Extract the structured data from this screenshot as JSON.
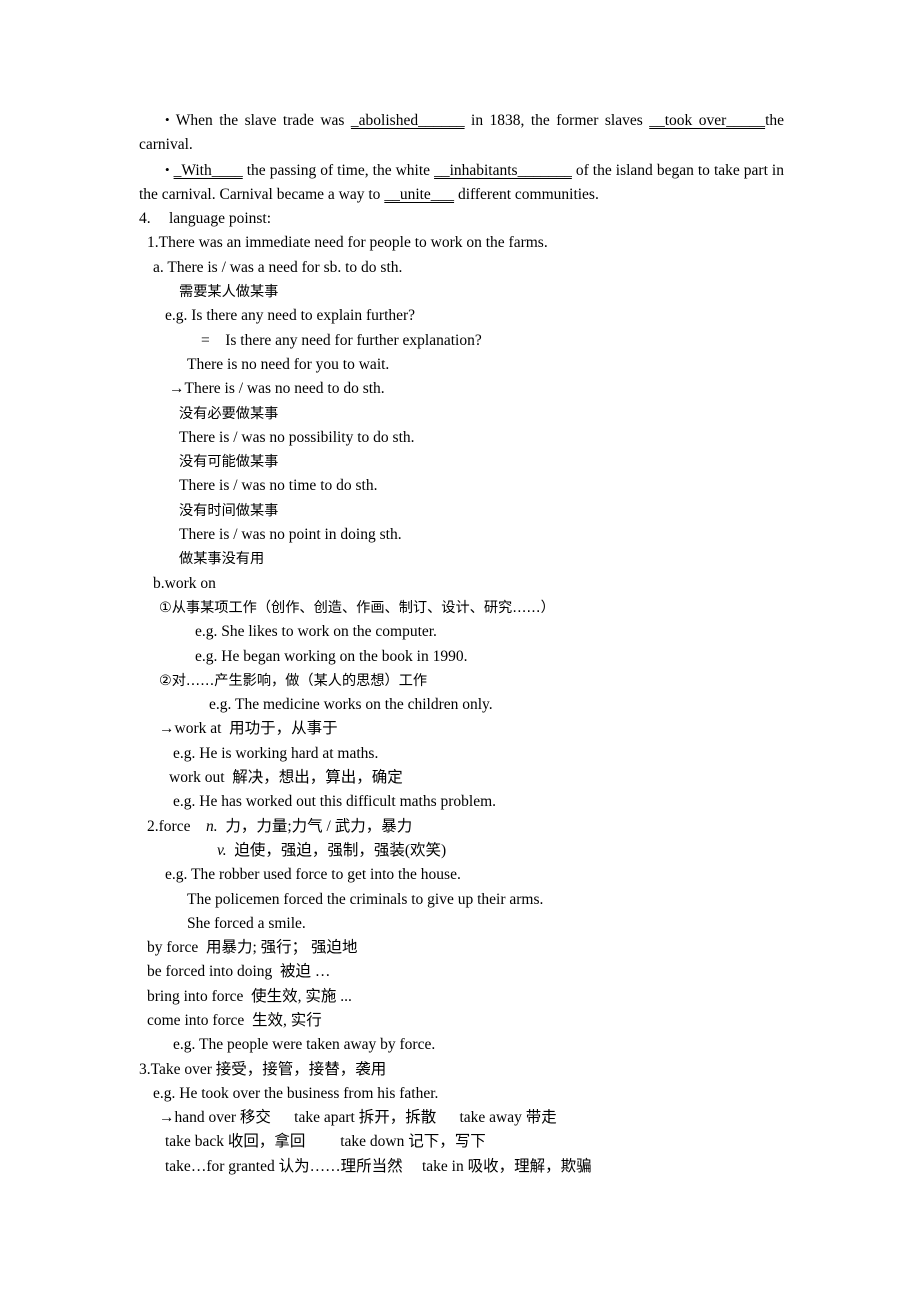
{
  "document": {
    "blanks_paragraph_1": {
      "part1": "When  the  slave  trade  was  ",
      "blank1": "_abolished______",
      "part2": "  in  1838,  the  former  slaves  ",
      "blank2": "__took over_____",
      "part3": "the carnival."
    },
    "blanks_paragraph_2": {
      "blank1": "_With____",
      "part1": " the passing of time, the white ",
      "blank2": "__inhabitants_______",
      "part2": " of the island began to take part in the carnival. Carnival became a way to ",
      "blank3": "__unite___",
      "part3": " different communities."
    },
    "bullet_char": "•",
    "section_number": "4.",
    "section_title": "language poinst:",
    "lines": [
      {
        "id": "l1",
        "indent": "i1",
        "text": "1.There was an immediate need for people to work on the farms."
      },
      {
        "id": "l2",
        "indent": "i2",
        "text": "a. There is / was a need for sb. to do sth."
      },
      {
        "id": "l3",
        "indent": "i7",
        "text": "需要某人做某事",
        "cn": true
      },
      {
        "id": "l4",
        "indent": "i4",
        "text": "e.g. Is there any need to explain further?"
      },
      {
        "id": "l5",
        "indent": "i10",
        "text": "=    Is there any need for further explanation?"
      },
      {
        "id": "l6",
        "indent": "i8",
        "text": "There is no need for you to wait."
      },
      {
        "id": "l7",
        "indent": "i5",
        "text": "→There is / was no need to do sth."
      },
      {
        "id": "l8",
        "indent": "i7",
        "text": "没有必要做某事",
        "cn": true
      },
      {
        "id": "l9",
        "indent": "i7",
        "text": "There is / was no possibility to do sth."
      },
      {
        "id": "l10",
        "indent": "i7",
        "text": "没有可能做某事",
        "cn": true
      },
      {
        "id": "l11",
        "indent": "i7",
        "text": "There is / was no time to do sth."
      },
      {
        "id": "l12",
        "indent": "i7",
        "text": "没有时间做某事",
        "cn": true
      },
      {
        "id": "l13",
        "indent": "i7",
        "text": "There is / was no point in doing sth."
      },
      {
        "id": "l14",
        "indent": "i7",
        "text": "做某事没有用",
        "cn": true
      },
      {
        "id": "l15",
        "indent": "i2",
        "text": "b.work on"
      },
      {
        "id": "l16",
        "indent": "i3",
        "text": "①从事某项工作（创作、创造、作画、制订、设计、研究……）",
        "cn": true
      },
      {
        "id": "l17",
        "indent": "i9",
        "text": "e.g. She likes to work on the computer."
      },
      {
        "id": "l18",
        "indent": "i9",
        "text": "e.g. He began working on the book in 1990."
      },
      {
        "id": "l19",
        "indent": "i3",
        "text": "②对……产生影响，做（某人的思想）工作",
        "cn": true
      },
      {
        "id": "l20",
        "indent": "i11",
        "text": "e.g. The medicine works on the children only."
      },
      {
        "id": "l21",
        "indent": "i3",
        "text": "→work at  用功于，从事于"
      },
      {
        "id": "l22",
        "indent": "i6",
        "text": "e.g. He is working hard at maths."
      },
      {
        "id": "l23",
        "indent": "i5",
        "text": "work out  解决，想出，算出，确定"
      },
      {
        "id": "l24",
        "indent": "i6",
        "text": "e.g. He has worked out this difficult maths problem."
      },
      {
        "id": "l25",
        "indent": "i1",
        "text": "2.force    n.  力，力量;力气 / 武力，暴力",
        "italic_head": "n."
      },
      {
        "id": "l26",
        "indent": "i12",
        "text": "v.  迫使，强迫，强制，强装(欢笑)",
        "italic_head": "v."
      },
      {
        "id": "l27",
        "indent": "i4",
        "text": "e.g. The robber used force to get into the house."
      },
      {
        "id": "l28",
        "indent": "i8",
        "text": "The policemen forced the criminals to give up their arms."
      },
      {
        "id": "l29",
        "indent": "i8",
        "text": "She forced a smile."
      },
      {
        "id": "l30",
        "indent": "i1",
        "text": "by force  用暴力; 强行； 强迫地"
      },
      {
        "id": "l31",
        "indent": "i1",
        "text": "be forced into doing  被迫 …"
      },
      {
        "id": "l32",
        "indent": "i1",
        "text": "bring into force  使生效, 实施 ..."
      },
      {
        "id": "l33",
        "indent": "i1",
        "text": "come into force  生效, 实行"
      },
      {
        "id": "l34",
        "indent": "i6",
        "text": "e.g. The people were taken away by force."
      },
      {
        "id": "l35",
        "indent": "i0",
        "text": "3.Take over 接受，接管，接替，袭用"
      },
      {
        "id": "l36",
        "indent": "i2",
        "text": "e.g. He took over the business from his father."
      },
      {
        "id": "l37",
        "indent": "i3",
        "text": "→hand over 移交      take apart 拆开，拆散      take away 带走"
      },
      {
        "id": "l38",
        "indent": "i4",
        "text": "take back 收回，拿回         take down 记下，写下"
      },
      {
        "id": "l39",
        "indent": "i4",
        "text": "take…for granted 认为……理所当然     take in 吸收，理解，欺骗"
      }
    ]
  }
}
